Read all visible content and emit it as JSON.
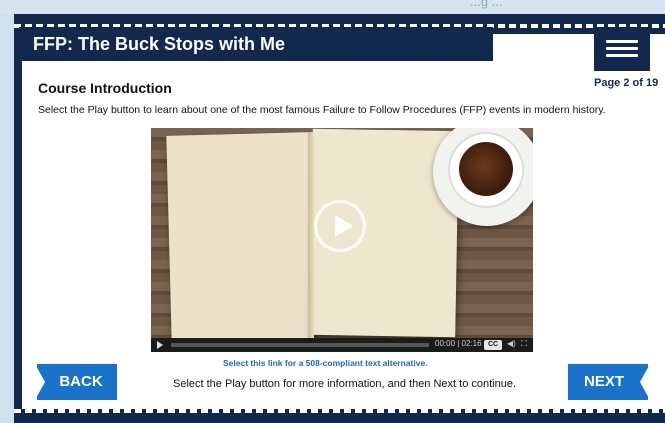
{
  "top_cut_text": "...g ...",
  "header": {
    "title": "FFP: The Buck Stops with Me",
    "page_count": "Page 2 of 19"
  },
  "content": {
    "section_title": "Course Introduction",
    "instruction": "Select the Play button to learn about one of the most famous Failure to Follow Procedures (FFP) events in modern history."
  },
  "video": {
    "time": "00:00 | 02:16",
    "cc_label": "CC",
    "volume_icon": "speaker-icon",
    "fullscreen_icon": "fullscreen-icon"
  },
  "footer": {
    "alt_link": "Select this link for a 508-compliant text alternative.",
    "instruction": "Select the Play button for more information, and then Next to continue.",
    "back_label": "BACK",
    "next_label": "NEXT"
  },
  "colors": {
    "navy": "#12294d",
    "accent_blue": "#1a73c9",
    "link_blue": "#2167b5"
  }
}
